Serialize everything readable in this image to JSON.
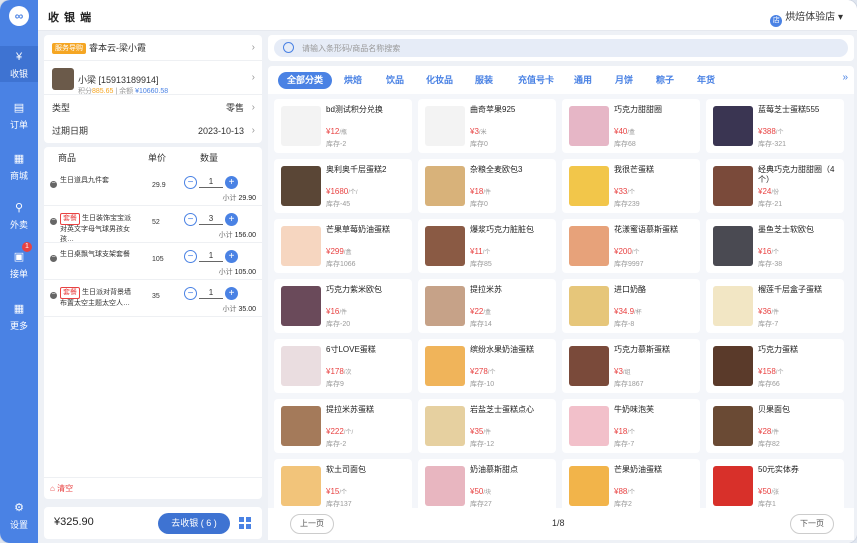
{
  "app": {
    "title": "收 银 端",
    "store": "烘焙体验店",
    "store_icon": "店"
  },
  "nav": [
    {
      "label": "收银",
      "icon": "¥"
    },
    {
      "label": "订单",
      "icon": "▤"
    },
    {
      "label": "商城",
      "icon": "▦"
    },
    {
      "label": "外卖",
      "icon": "⚲"
    },
    {
      "label": "接单",
      "icon": "▣",
      "badge": "1"
    },
    {
      "label": "更多",
      "icon": "▦"
    },
    {
      "label": "设置",
      "icon": "⚙"
    }
  ],
  "guide": {
    "tag": "服务导购",
    "name": "睿本云-梁小霞"
  },
  "customer": {
    "name": "小梁 [15913189914]",
    "points_label": "积分",
    "points": "885.65",
    "balance_label": "余额",
    "balance": "¥10660.58"
  },
  "order_info": {
    "type_label": "类型",
    "type_value": "零售",
    "date_label": "过期日期",
    "date_value": "2023-10-13"
  },
  "order_table": {
    "headers": {
      "name": "商品",
      "price": "单价",
      "qty": "数量"
    },
    "subtotal_label": "小计",
    "items": [
      {
        "tag": "",
        "name": "生日道具九件套",
        "price": "29.9",
        "qty": "1",
        "subtotal": "29.90"
      },
      {
        "tag": "套餐",
        "name": "生日装饰宝宝派对英文字母气球男孩女孩…",
        "price": "52",
        "qty": "3",
        "subtotal": "156.00"
      },
      {
        "tag": "",
        "name": "生日桌飘气球支架套餐",
        "price": "105",
        "qty": "1",
        "subtotal": "105.00"
      },
      {
        "tag": "套餐",
        "name": "生日派对背景墙布置太空主题太空人…",
        "price": "35",
        "qty": "1",
        "subtotal": "35.00"
      }
    ]
  },
  "clear_label": "清空",
  "footer": {
    "total": "¥325.90",
    "checkout": "去收银 ( 6 )"
  },
  "search": {
    "placeholder": "请输入条形码/商品名称搜索"
  },
  "categories": [
    "全部分类",
    "烘焙",
    "饮品",
    "化妆品",
    "服装",
    "充值号卡",
    "通用",
    "月饼",
    "粽子",
    "年货"
  ],
  "stock_label": "库存",
  "products": [
    {
      "name": "bd测试积分兑换",
      "price": "¥12",
      "unit": "/瓶",
      "stock": "-2",
      "color": "#f3f3f3"
    },
    {
      "name": "曲奇苹果925",
      "price": "¥3",
      "unit": "/米",
      "stock": "0",
      "color": "#f3f3f3"
    },
    {
      "name": "巧克力甜甜圈",
      "price": "¥40",
      "unit": "/盒",
      "stock": "68",
      "color": "#e6b6c6"
    },
    {
      "name": "蓝莓芝士蛋糕555",
      "price": "¥388",
      "unit": "/个",
      "stock": "-321",
      "color": "#3a3552"
    },
    {
      "name": "奥利奥千层蛋糕2",
      "price": "¥1680",
      "unit": "/个/",
      "stock": "-45",
      "color": "#5a4636"
    },
    {
      "name": "杂粮全麦欧包3",
      "price": "¥18",
      "unit": "/件",
      "stock": "0",
      "color": "#d8b27a"
    },
    {
      "name": "我很芒蛋糕",
      "price": "¥33",
      "unit": "/个",
      "stock": "239",
      "color": "#f2c64a"
    },
    {
      "name": "经典巧克力甜甜圈（4个）",
      "price": "¥24",
      "unit": "/份",
      "stock": "-21",
      "color": "#7a4a3a"
    },
    {
      "name": "芒果草莓奶油蛋糕",
      "price": "¥299",
      "unit": "/盒",
      "stock": "1066",
      "color": "#f6d6c0"
    },
    {
      "name": "爆浆巧克力脏脏包",
      "price": "¥11",
      "unit": "/个",
      "stock": "85",
      "color": "#8a5a44"
    },
    {
      "name": "花漾蜜语慕斯蛋糕",
      "price": "¥200",
      "unit": "/个",
      "stock": "9997",
      "color": "#e7a27a"
    },
    {
      "name": "墨鱼芝士软欧包",
      "price": "¥16",
      "unit": "/个",
      "stock": "-38",
      "color": "#4a4a52"
    },
    {
      "name": "巧克力紫米欧包",
      "price": "¥16",
      "unit": "/件",
      "stock": "-20",
      "color": "#6a4a5a"
    },
    {
      "name": "提拉米苏",
      "price": "¥22",
      "unit": "/盒",
      "stock": "14",
      "color": "#c6a288"
    },
    {
      "name": "进口奶酪",
      "price": "¥34.9",
      "unit": "/杯",
      "stock": "-8",
      "color": "#e6c67a"
    },
    {
      "name": "榴莲千层盒子蛋糕",
      "price": "¥36",
      "unit": "/件",
      "stock": "-7",
      "color": "#f2e6c4"
    },
    {
      "name": "6寸LOVE蛋糕",
      "price": "¥178",
      "unit": "/次",
      "stock": "9",
      "color": "#eadde0"
    },
    {
      "name": "缤纷水果奶油蛋糕",
      "price": "¥278",
      "unit": "/个",
      "stock": "-10",
      "color": "#f0b45a"
    },
    {
      "name": "巧克力慕斯蛋糕",
      "price": "¥3",
      "unit": "/组",
      "stock": "1867",
      "color": "#7a4a3a"
    },
    {
      "name": "巧克力蛋糕",
      "price": "¥158",
      "unit": "/个",
      "stock": "66",
      "color": "#5a3a2a"
    },
    {
      "name": "提拉米苏蛋糕",
      "price": "¥222",
      "unit": "/个/",
      "stock": "-2",
      "color": "#a47a5a"
    },
    {
      "name": "岩盐芝士蛋糕点心",
      "price": "¥35",
      "unit": "/件",
      "stock": "-12",
      "color": "#e6d0a0"
    },
    {
      "name": "牛奶味泡芙",
      "price": "¥18",
      "unit": "/个",
      "stock": "-7",
      "color": "#f2c0ca"
    },
    {
      "name": "贝果面包",
      "price": "¥28",
      "unit": "/件",
      "stock": "82",
      "color": "#6a4a34"
    },
    {
      "name": "软土司面包",
      "price": "¥15",
      "unit": "/个",
      "stock": "137",
      "color": "#f2c47a"
    },
    {
      "name": "奶油慕斯甜点",
      "price": "¥50",
      "unit": "/块",
      "stock": "27",
      "color": "#e8b6c0"
    },
    {
      "name": "芒果奶油蛋糕",
      "price": "¥88",
      "unit": "/个",
      "stock": "2",
      "color": "#f2b44a"
    },
    {
      "name": "50元实体券",
      "price": "¥50",
      "unit": "/张",
      "stock": "1",
      "color": "#d8302a"
    }
  ],
  "pager": {
    "prev": "上一页",
    "page": "1/8",
    "next": "下一页"
  }
}
